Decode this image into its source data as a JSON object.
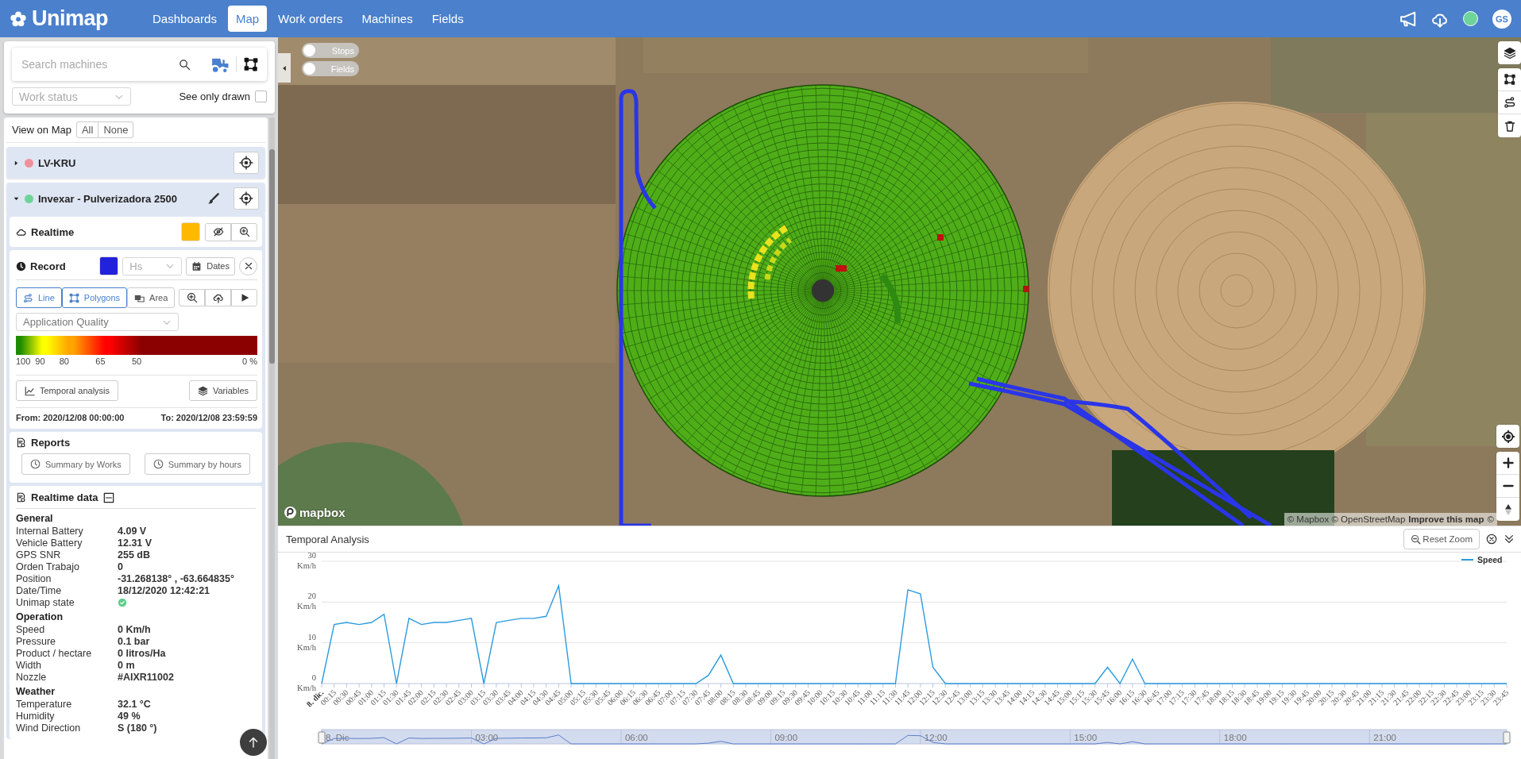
{
  "top_bar": {
    "logo": "Unimap",
    "nav": [
      {
        "label": "Dashboards",
        "selected": false
      },
      {
        "label": "Map",
        "selected": true
      },
      {
        "label": "Work orders",
        "selected": false
      },
      {
        "label": "Machines",
        "selected": false
      },
      {
        "label": "Fields",
        "selected": false
      }
    ],
    "status_online": true,
    "avatar": "GS"
  },
  "sidebar": {
    "search": {
      "placeholder": "Search machines"
    },
    "work_status": {
      "placeholder": "Work status"
    },
    "see_only_drawn": {
      "label": "See only drawn",
      "checked": false
    },
    "view_on_map": {
      "label": "View on Map",
      "buttons": [
        "All",
        "None"
      ]
    },
    "machines": [
      {
        "name": "LV-KRU",
        "color": "#f0909c",
        "expanded": false
      },
      {
        "name": "Invexar - Pulverizadora 2500",
        "color": "#6dd49a",
        "expanded": true,
        "realtime": {
          "label": "Realtime",
          "color": "#ffb800"
        },
        "record": {
          "label": "Record",
          "color": "#2222dd",
          "interval": {
            "placeholder": "Hs"
          },
          "dates": "Dates",
          "modes": [
            {
              "kind": "line",
              "label": "Line",
              "selected": true
            },
            {
              "kind": "polygons",
              "label": "Polygons",
              "selected": true
            },
            {
              "kind": "area",
              "label": "Area",
              "selected": false
            }
          ],
          "variable": "Application Quality",
          "legend": [
            {
              "label": "100",
              "color": "#1e8c00"
            },
            {
              "label": "90",
              "color": "#ffff00"
            },
            {
              "label": "80",
              "color": "#ffa500"
            },
            {
              "label": "65",
              "color": "#ff0000"
            },
            {
              "label": "50",
              "color": "#8b0000"
            },
            {
              "label": "0 %",
              "color": "#8b0000"
            }
          ],
          "temporal_button": "Temporal analysis",
          "variables_button": "Variables",
          "from": "From: 2020/12/08 00:00:00",
          "to": "To: 2020/12/08 23:59:59"
        },
        "reports": {
          "title": "Reports",
          "buttons": [
            "Summary by Works",
            "Summary by hours"
          ]
        },
        "realtime_data": {
          "title": "Realtime data",
          "expanded": true,
          "groups": [
            {
              "title": "General",
              "rows": [
                {
                  "kind": "text",
                  "label": "Internal Battery",
                  "value": "4.09 V"
                },
                {
                  "kind": "text",
                  "label": "Vehicle Battery",
                  "value": "12.31 V"
                },
                {
                  "kind": "text",
                  "label": "GPS SNR",
                  "value": "255 dB"
                },
                {
                  "kind": "text",
                  "label": "Orden Trabajo",
                  "value": "0"
                },
                {
                  "kind": "text",
                  "label": "Position",
                  "value": "-31.268138° , -63.664835°"
                },
                {
                  "kind": "text",
                  "label": "Date/Time",
                  "value": "18/12/2020 12:42:21"
                },
                {
                  "kind": "status",
                  "label": "Unimap state",
                  "ok": true
                }
              ]
            },
            {
              "title": "Operation",
              "rows": [
                {
                  "kind": "text",
                  "label": "Speed",
                  "value": "0 Km/h"
                },
                {
                  "kind": "text",
                  "label": "Pressure",
                  "value": "0.1 bar"
                },
                {
                  "kind": "text",
                  "label": "Product / hectare",
                  "value": "0 litros/Ha"
                },
                {
                  "kind": "text",
                  "label": "Width",
                  "value": "0 m"
                },
                {
                  "kind": "text",
                  "label": "Nozzle",
                  "value": "#AIXR11002"
                }
              ]
            },
            {
              "title": "Weather",
              "rows": [
                {
                  "kind": "text",
                  "label": "Temperature",
                  "value": "32.1 °C"
                },
                {
                  "kind": "text",
                  "label": "Humidity",
                  "value": "49 %"
                },
                {
                  "kind": "text",
                  "label": "Wind Direction",
                  "value": "S (180 °)"
                }
              ]
            }
          ]
        }
      }
    ]
  },
  "map": {
    "toggles": [
      {
        "label": "Stops",
        "on": false
      },
      {
        "label": "Fields",
        "on": false
      }
    ],
    "logo": "mapbox",
    "attribution": "© Mapbox © OpenStreetMap",
    "improve_link": "Improve this map",
    "attribution_tail": "©"
  },
  "temporal_analysis": {
    "title": "Temporal Analysis",
    "reset_zoom": "Reset Zoom",
    "chart_data": {
      "type": "line",
      "categories": [
        "8. dic.",
        "00:15",
        "00:30",
        "00:45",
        "01:00",
        "01:15",
        "01:30",
        "01:45",
        "02:00",
        "02:15",
        "02:30",
        "02:45",
        "03:00",
        "03:15",
        "03:30",
        "03:45",
        "04:00",
        "04:15",
        "04:30",
        "04:45",
        "05:00",
        "05:15",
        "05:30",
        "05:45",
        "06:00",
        "06:15",
        "06:30",
        "06:45",
        "07:00",
        "07:15",
        "07:30",
        "07:45",
        "08:00",
        "08:15",
        "08:30",
        "08:45",
        "09:00",
        "09:15",
        "09:30",
        "09:45",
        "10:00",
        "10:15",
        "10:30",
        "10:45",
        "11:00",
        "11:15",
        "11:30",
        "11:45",
        "12:00",
        "12:15",
        "12:30",
        "12:45",
        "13:00",
        "13:15",
        "13:30",
        "13:45",
        "14:00",
        "14:15",
        "14:30",
        "14:45",
        "15:00",
        "15:15",
        "15:30",
        "15:45",
        "16:00",
        "16:15",
        "16:30",
        "16:45",
        "17:00",
        "17:15",
        "17:30",
        "17:45",
        "18:00",
        "18:15",
        "18:30",
        "18:45",
        "19:00",
        "19:15",
        "19:30",
        "19:45",
        "20:00",
        "20:15",
        "20:30",
        "20:45",
        "21:00",
        "21:15",
        "21:30",
        "21:45",
        "22:00",
        "22:15",
        "22:30",
        "22:45",
        "23:00",
        "23:15",
        "23:30",
        "23:45"
      ],
      "series": [
        {
          "name": "Speed",
          "color": "#2b9be0",
          "values": [
            0,
            14.5,
            15,
            14.5,
            15,
            17,
            0,
            16,
            14.5,
            15,
            15,
            15.5,
            16,
            0,
            15,
            15.5,
            16,
            16,
            16.5,
            24,
            0,
            0,
            0,
            0,
            0,
            0,
            0,
            0,
            0,
            0,
            0,
            2,
            7,
            0,
            0,
            0,
            0,
            0,
            0,
            0,
            0,
            0,
            0,
            0,
            0,
            0,
            0,
            23,
            22,
            4,
            0,
            0,
            0,
            0,
            0,
            0,
            0,
            0,
            0,
            0,
            0,
            0,
            0,
            4,
            0,
            6,
            0,
            0,
            0,
            0,
            0,
            0,
            0,
            0,
            0,
            0,
            0,
            0,
            0,
            0,
            0,
            0,
            0,
            0,
            0,
            0,
            0,
            0,
            0,
            0,
            0,
            0,
            0,
            0,
            0,
            0
          ]
        }
      ],
      "ylim": [
        0,
        30
      ],
      "yticks": [
        {
          "value": 0,
          "label": "0 Km/h"
        },
        {
          "value": 10,
          "label": "10 Km/h"
        },
        {
          "value": 20,
          "label": "20 Km/h"
        },
        {
          "value": 30,
          "label": "30 Km/h"
        }
      ]
    },
    "navigator": {
      "labels": [
        "8. Dic",
        "03:00",
        "06:00",
        "09:00",
        "12:00",
        "15:00",
        "18:00",
        "21:00"
      ]
    }
  }
}
